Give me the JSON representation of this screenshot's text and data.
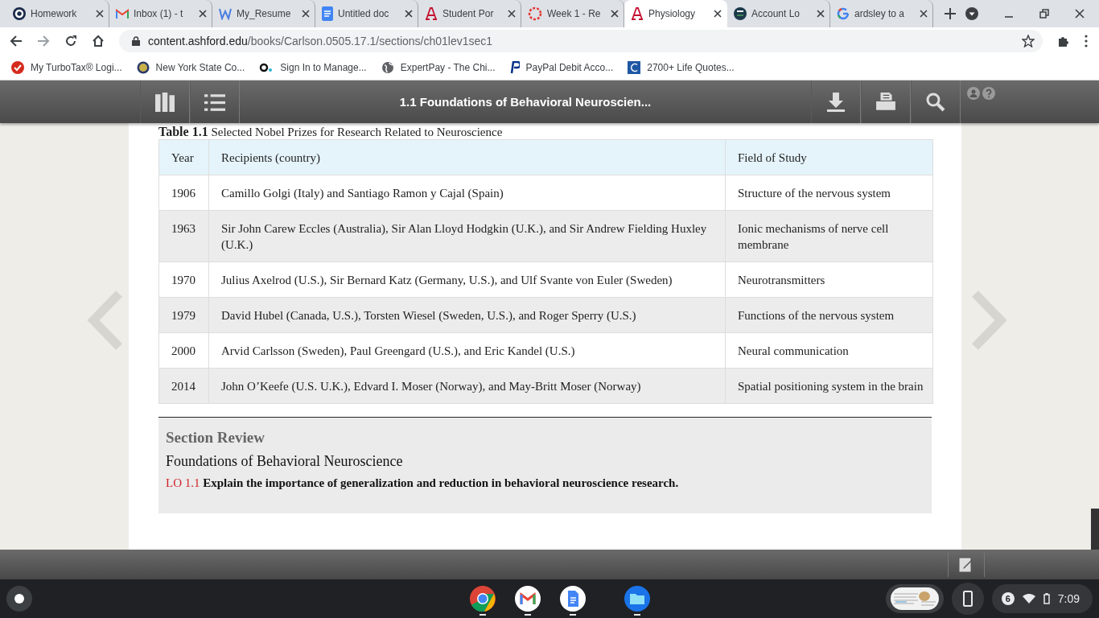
{
  "browser": {
    "tabs": [
      {
        "title": "Homework",
        "kind": "ring",
        "selected": false
      },
      {
        "title": "Inbox (1) - t",
        "kind": "mail",
        "selected": false
      },
      {
        "title": "My_Resume",
        "kind": "word",
        "selected": false
      },
      {
        "title": "Untitled doc",
        "kind": "doc",
        "selected": false
      },
      {
        "title": "Student Por",
        "kind": "school",
        "selected": false
      },
      {
        "title": "Week 1 - Re",
        "kind": "dotted",
        "selected": false
      },
      {
        "title": "Physiology",
        "kind": "school",
        "selected": true
      },
      {
        "title": "Account Lo",
        "kind": "badge",
        "selected": false
      },
      {
        "title": "ardsley to a",
        "kind": "search",
        "selected": false
      }
    ],
    "address": {
      "host": "content.ashford.edu",
      "path": "/books/Carlson.0505.17.1/sections/ch01lev1sec1"
    },
    "bookmarks": [
      {
        "label": "My TurboTax® Logi...",
        "kind": "check"
      },
      {
        "label": "New York State Co...",
        "kind": "seal"
      },
      {
        "label": "Sign In to Manage...",
        "kind": "dots"
      },
      {
        "label": "ExpertPay - The Chi...",
        "kind": "globe"
      },
      {
        "label": "PayPal Debit Acco...",
        "kind": "pay"
      },
      {
        "label": "2700+ Life Quotes...",
        "kind": "quote"
      }
    ]
  },
  "reader": {
    "title": "1.1 Foundations of Behavioral Neuroscien...",
    "table": {
      "caption_label": "Table 1.1",
      "caption": "Selected Nobel Prizes for Research Related to Neuroscience",
      "columns": [
        "Year",
        "Recipients (country)",
        "Field of Study"
      ],
      "rows": [
        [
          "1906",
          "Camillo Golgi (Italy) and Santiago Ramon y Cajal (Spain)",
          "Structure of the nervous system"
        ],
        [
          "1963",
          "Sir John Carew Eccles (Australia), Sir Alan Lloyd Hodgkin (U.K.), and Sir Andrew Fielding Huxley (U.K.)",
          "Ionic mechanisms of nerve cell membrane"
        ],
        [
          "1970",
          "Julius Axelrod (U.S.), Sir Bernard Katz (Germany, U.S.), and Ulf Svante von Euler (Sweden)",
          "Neurotransmitters"
        ],
        [
          "1979",
          "David Hubel (Canada, U.S.), Torsten Wiesel (Sweden, U.S.), and Roger Sperry (U.S.)",
          "Functions of the nervous system"
        ],
        [
          "2000",
          "Arvid Carlsson (Sweden), Paul Greengard (U.S.), and Eric Kandel (U.S.)",
          "Neural communication"
        ],
        [
          "2014",
          "John O’Keefe (U.S. U.K.), Edvard I. Moser (Norway), and May-Britt Moser (Norway)",
          "Spatial positioning system in the brain"
        ]
      ]
    },
    "review": {
      "heading": "Section Review",
      "subheading": "Foundations of Behavioral Neuroscience",
      "objective_label": "LO 1.1",
      "objective": "Explain the importance of generalization and reduction in behavioral neuroscience research."
    }
  },
  "shelf": {
    "apps": [
      {
        "kind": "chrome"
      },
      {
        "kind": "mail"
      },
      {
        "kind": "docs"
      },
      {
        "kind": "files"
      }
    ],
    "notification_count": "6",
    "time": "7:09"
  }
}
